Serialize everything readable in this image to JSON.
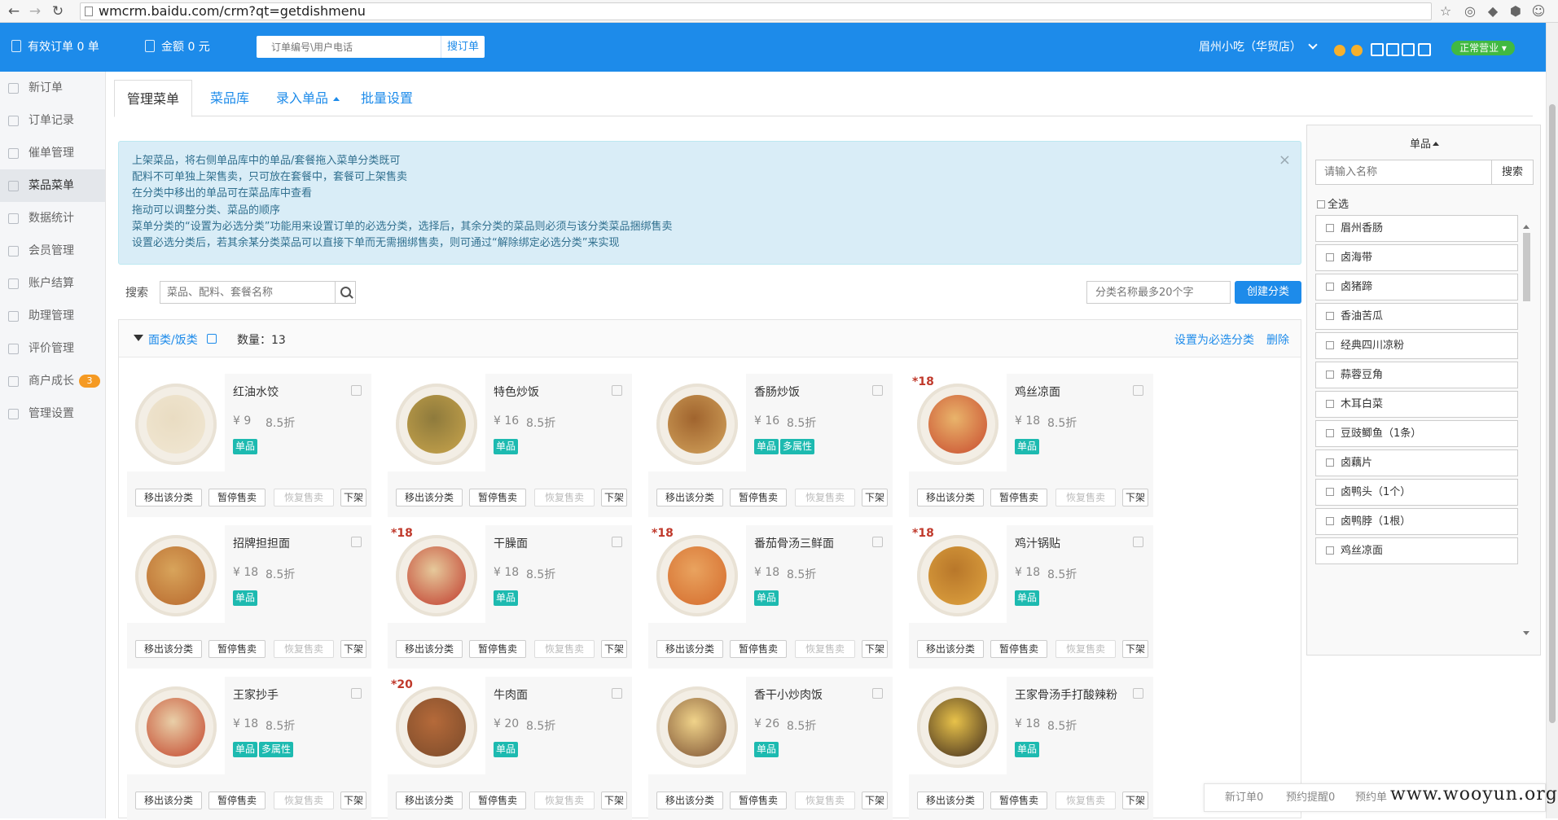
{
  "browser": {
    "url": "wmcrm.baidu.com/crm?qt=getdishmenu"
  },
  "header": {
    "valid_orders": "有效订单 0 单",
    "amount": "金额 0 元",
    "search_placeholder": "订单编号\\用户电话",
    "search_button": "搜订单",
    "store_name": "眉州小吃（华贸店）",
    "status": "正常营业"
  },
  "sidebar": {
    "items": [
      {
        "label": "新订单",
        "icon": "new-order-icon"
      },
      {
        "label": "订单记录",
        "icon": "order-record-icon"
      },
      {
        "label": "催单管理",
        "icon": "reminder-icon"
      },
      {
        "label": "菜品菜单",
        "icon": "menu-icon"
      },
      {
        "label": "数据统计",
        "icon": "stats-icon"
      },
      {
        "label": "会员管理",
        "icon": "member-icon"
      },
      {
        "label": "账户结算",
        "icon": "account-icon"
      },
      {
        "label": "助理管理",
        "icon": "assistant-icon"
      },
      {
        "label": "评价管理",
        "icon": "review-icon"
      },
      {
        "label": "商户成长",
        "icon": "growth-icon",
        "badge": "3"
      },
      {
        "label": "管理设置",
        "icon": "settings-icon"
      }
    ]
  },
  "tabs": [
    "管理菜单",
    "菜品库",
    "录入单品",
    "批量设置"
  ],
  "alert": {
    "lines": [
      "上架菜品，将右侧单品库中的单品/套餐拖入菜单分类既可",
      "配料不可单独上架售卖，只可放在套餐中，套餐可上架售卖",
      "在分类中移出的单品可在菜品库中查看",
      "拖动可以调整分类、菜品的顺序",
      "菜单分类的“设置为必选分类”功能用来设置订单的必选分类，选择后，其余分类的菜品则必须与该分类菜品捆绑售卖",
      "设置必选分类后，若其余某分类菜品可以直接下单而无需捆绑售卖，则可通过“解除绑定必选分类”来实现"
    ],
    "close": "×"
  },
  "toolbar": {
    "search_label": "搜索",
    "search_placeholder": "菜品、配料、套餐名称",
    "category_placeholder": "分类名称最多20个字",
    "create_button": "创建分类"
  },
  "category": {
    "name": "面类/饭类",
    "count": "数量：13",
    "set_required": "设置为必选分类",
    "delete": "删除"
  },
  "card_ops": [
    "移出该分类",
    "暂停售卖",
    "恢复售卖",
    "下架"
  ],
  "dishes": [
    {
      "name": "红油水饺",
      "price": "¥ 9",
      "discount": "8.5折",
      "tags": [
        "单品"
      ],
      "price_tag": "",
      "colors": [
        "#f1e7d3",
        "#e9dcc2"
      ]
    },
    {
      "name": "特色炒饭",
      "price": "¥ 16",
      "discount": "8.5折",
      "tags": [
        "单品"
      ],
      "price_tag": "",
      "colors": [
        "#c9a54c",
        "#8e7a3c"
      ]
    },
    {
      "name": "香肠炒饭",
      "price": "¥ 16",
      "discount": "8.5折",
      "tags": [
        "单品",
        "多属性"
      ],
      "price_tag": "",
      "colors": [
        "#d3a35c",
        "#a0642e"
      ]
    },
    {
      "name": "鸡丝凉面",
      "price": "¥ 18",
      "discount": "8.5折",
      "tags": [
        "单品"
      ],
      "price_tag": "*18",
      "colors": [
        "#c84a2e",
        "#e9b46b"
      ]
    },
    {
      "name": "招牌担担面",
      "price": "¥ 18",
      "discount": "8.5折",
      "tags": [
        "单品"
      ],
      "price_tag": "",
      "colors": [
        "#b7672c",
        "#d8a45b"
      ]
    },
    {
      "name": "干臊面",
      "price": "¥ 18",
      "discount": "8.5折",
      "tags": [
        "单品"
      ],
      "price_tag": "*18",
      "colors": [
        "#c0392b",
        "#e6c99b"
      ]
    },
    {
      "name": "番茄骨汤三鲜面",
      "price": "¥ 18",
      "discount": "8.5折",
      "tags": [
        "单品"
      ],
      "price_tag": "*18",
      "colors": [
        "#d46a2b",
        "#e9a35f"
      ]
    },
    {
      "name": "鸡汁锅贴",
      "price": "¥ 18",
      "discount": "8.5折",
      "tags": [
        "单品"
      ],
      "price_tag": "*18",
      "colors": [
        "#e0a440",
        "#b8772a"
      ]
    },
    {
      "name": "王家抄手",
      "price": "¥ 18",
      "discount": "8.5折",
      "tags": [
        "单品",
        "多属性"
      ],
      "price_tag": "",
      "colors": [
        "#c3442a",
        "#e9cfa8"
      ]
    },
    {
      "name": "牛肉面",
      "price": "¥ 20",
      "discount": "8.5折",
      "tags": [
        "单品"
      ],
      "price_tag": "*20",
      "colors": [
        "#7a4a2a",
        "#b56a3a"
      ]
    },
    {
      "name": "香干小炒肉饭",
      "price": "¥ 26",
      "discount": "8.5折",
      "tags": [
        "单品"
      ],
      "price_tag": "",
      "colors": [
        "#7b5032",
        "#f0d38a"
      ]
    },
    {
      "name": "王家骨汤手打酸辣粉",
      "price": "¥ 18",
      "discount": "8.5折",
      "tags": [
        "单品"
      ],
      "price_tag": "",
      "colors": [
        "#3e2a1c",
        "#e8c24a"
      ]
    }
  ],
  "right_panel": {
    "title": "单品",
    "search_placeholder": "请输入名称",
    "search_button": "搜索",
    "select_all": "全选",
    "items": [
      "眉州香肠",
      "卤海带",
      "卤猪蹄",
      "香油苦瓜",
      "经典四川凉粉",
      "蒜蓉豆角",
      "木耳白菜",
      "豆豉鲫鱼（1条）",
      "卤藕片",
      "卤鸭头（1个）",
      "卤鸭脖（1根）",
      "鸡丝凉面"
    ]
  },
  "notice": {
    "items": [
      "新订单0",
      "预约提醒0",
      "预约单"
    ]
  },
  "watermark": "www.wooyun.org",
  "colors": {
    "brand": "#1d8bea",
    "tag": "#1dbab0",
    "status": "#41b942",
    "badge": "#f59a23"
  }
}
